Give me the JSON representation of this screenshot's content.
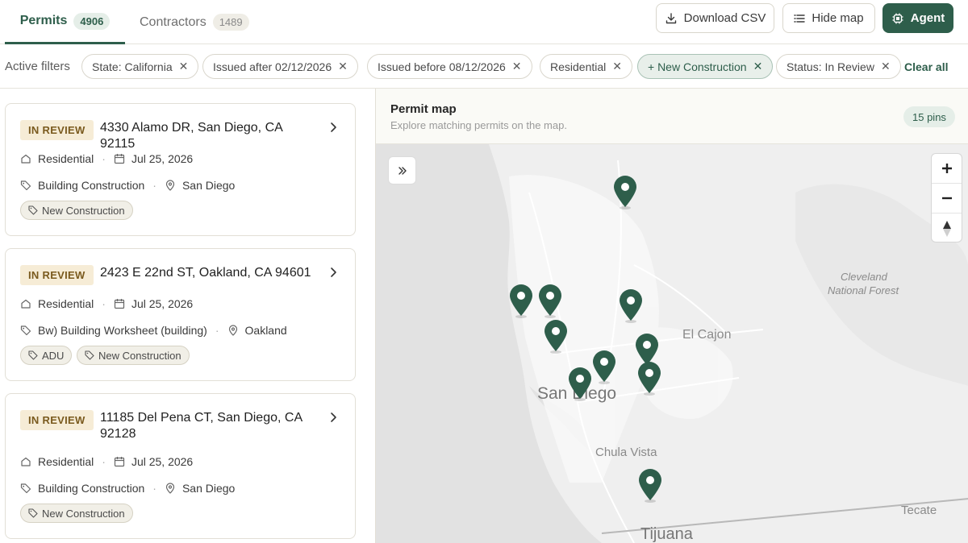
{
  "tabs": [
    {
      "label": "Permits",
      "count": "4906"
    },
    {
      "label": "Contractors",
      "count": "1489"
    }
  ],
  "actions": {
    "download": "Download CSV",
    "hide_map": "Hide map",
    "agent": "Agent"
  },
  "filters": {
    "label": "Active filters",
    "chips": [
      "State: California",
      "Issued after 02/12/2026",
      "Issued before 08/12/2026",
      "Residential",
      "+ New Construction",
      "Status: In Review"
    ],
    "clear_all": "Clear all"
  },
  "permits": [
    {
      "status": "IN REVIEW",
      "address": "4330 Alamo DR, San Diego, CA 92115",
      "type": "Residential",
      "date": "Jul 25, 2026",
      "work": "Building Construction",
      "city": "San Diego",
      "tags": [
        "New Construction"
      ]
    },
    {
      "status": "IN REVIEW",
      "address": "2423 E 22nd ST, Oakland, CA 94601",
      "type": "Residential",
      "date": "Jul 25, 2026",
      "work": "Bw) Building Worksheet (building)",
      "city": "Oakland",
      "tags": [
        "ADU",
        "New Construction"
      ]
    },
    {
      "status": "IN REVIEW",
      "address": "11185 Del Pena CT, San Diego, CA 92128",
      "type": "Residential",
      "date": "Jul 25, 2026",
      "work": "Building Construction",
      "city": "San Diego",
      "tags": [
        "New Construction"
      ]
    }
  ],
  "map": {
    "title": "Permit map",
    "subtitle": "Explore matching permits on the map.",
    "pins_badge": "15 pins",
    "labels": {
      "cleveland": "Cleveland",
      "national_forest": "National Forest",
      "el_cajon": "El Cajon",
      "san_diego": "San Diego",
      "chula_vista": "Chula Vista",
      "tecate": "Tecate",
      "tijuana": "Tijuana"
    },
    "pin_color": "#2e5e4b"
  },
  "colors": {
    "accent": "#2e5e4b",
    "status_badge_bg": "#f6ecd6",
    "status_badge_text": "#7a5a1e"
  }
}
